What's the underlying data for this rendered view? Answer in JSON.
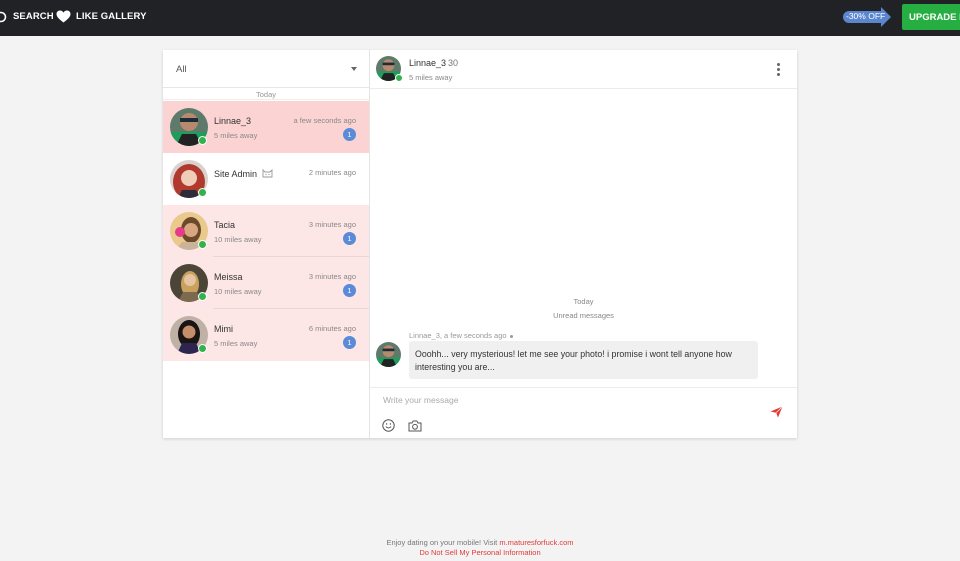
{
  "topbar": {
    "search_label": "SEARCH",
    "like_label": "LIKE GALLERY",
    "discount_label": "-30% OFF",
    "upgrade_label": "UPGRADE NOW",
    "accent_color": "#27ae43"
  },
  "inbox": {
    "filter_value": "All",
    "day_separator": "Today",
    "conversations": [
      {
        "name": "Linnae_3",
        "distance": "5 miles away",
        "time": "a few seconds ago",
        "unread": "1"
      },
      {
        "name": "Site Admin",
        "distance": "",
        "time": "2 minutes ago",
        "unread": ""
      },
      {
        "name": "Tacia",
        "distance": "10 miles away",
        "time": "3 minutes ago",
        "unread": "1"
      },
      {
        "name": "Meissa",
        "distance": "10 miles away",
        "time": "3 minutes ago",
        "unread": "1"
      },
      {
        "name": "Mimi",
        "distance": "5 miles away",
        "time": "6 minutes ago",
        "unread": "1"
      }
    ]
  },
  "chat": {
    "header": {
      "name": "Linnae_3",
      "age": "30",
      "distance": "5 miles away"
    },
    "day_label": "Today",
    "unread_label": "Unread messages",
    "messages": [
      {
        "meta": "Linnae_3, a few seconds ago",
        "text": "Ooohh... very mysterious! let me see your photo! i promise i wont tell anyone how interesting you are..."
      }
    ],
    "composer": {
      "placeholder": "Write your message"
    }
  },
  "footer": {
    "mobile_text": "Enjoy dating on your mobile! Visit",
    "mobile_link": "m.maturesforfuck.com",
    "privacy_link": "Do Not Sell My Personal Information"
  }
}
